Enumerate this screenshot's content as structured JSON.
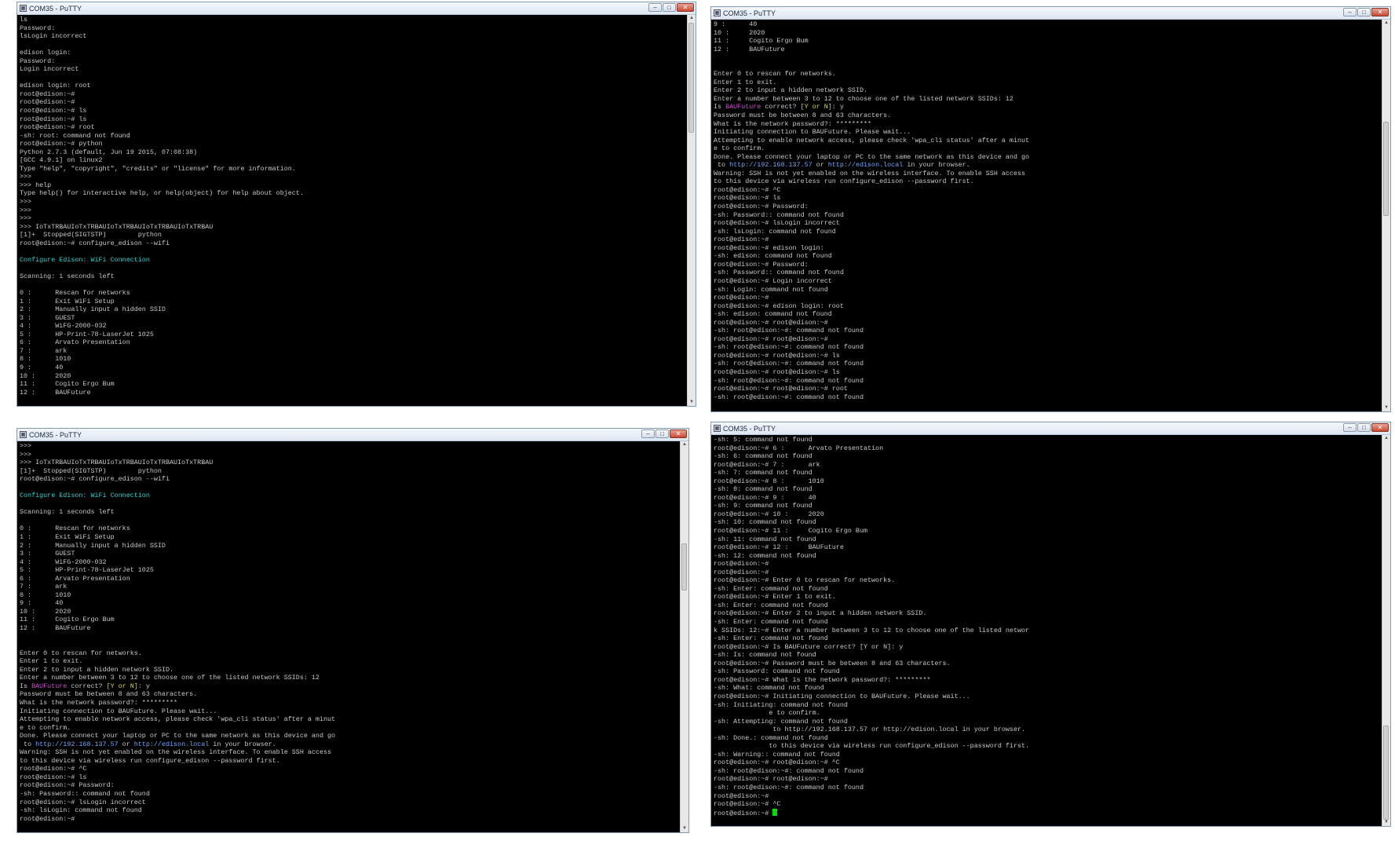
{
  "windows": [
    {
      "title": "COM35 - PuTTY",
      "lines": [
        "ls",
        "Password:",
        "lsLogin incorrect",
        "",
        "edison login:",
        "Password:",
        "Login incorrect",
        "",
        "edison login: root",
        "root@edison:~#",
        "root@edison:~#",
        "root@edison:~# ls",
        "root@edison:~# ls",
        "root@edison:~# root",
        "-sh: root: command not found",
        "root@edison:~# python",
        "Python 2.7.3 (default, Jun 19 2015, 07:08:38)",
        "[GCC 4.9.1] on linux2",
        "Type \"help\", \"copyright\", \"credits\" or \"license\" for more information.",
        ">>>",
        ">>> help",
        "Type help() for interactive help, or help(object) for help about object.",
        ">>>",
        ">>>",
        ">>>",
        ">>> IoTxTRBAUIoTxTRBAUIoTxTRBAUIoTxTRBAUIoTxTRBAU",
        "[1]+  Stopped(SIGTSTP)        python",
        "root@edison:~# configure_edison --wifi",
        "",
        [
          {
            "t": "Configure Edison: WiFi Connection",
            "c": "cyan"
          }
        ],
        "",
        "Scanning: 1 seconds left",
        "",
        "0 :      Rescan for networks",
        "1 :      Exit WiFi Setup",
        "2 :      Manually input a hidden SSID",
        "3 :      GUEST",
        "4 :      WiFG-2000-032",
        "5 :      HP-Print-78-LaserJet 1025",
        "6 :      Arvato Presentation",
        "7 :      ark",
        "8 :      1010",
        "9 :      40",
        "10 :     2020",
        "11 :     Cogito Ergo Bum",
        "12 :     BAUFuture"
      ]
    },
    {
      "title": "COM35 - PuTTY",
      "lines": [
        "9 :      40",
        "10 :     2020",
        "11 :     Cogito Ergo Bum",
        "12 :     BAUFuture",
        "",
        "",
        "Enter 0 to rescan for networks.",
        "Enter 1 to exit.",
        "Enter 2 to input a hidden network SSID.",
        "Enter a number between 3 to 12 to choose one of the listed network SSIDs: 12",
        [
          {
            "t": "Is "
          },
          {
            "t": "BAUFuture",
            "c": "magenta"
          },
          {
            "t": " correct? "
          },
          {
            "t": "[Y or N]",
            "c": "yellow"
          },
          {
            "t": ": y"
          }
        ],
        "Password must be between 8 and 63 characters.",
        "What is the network password?: *********",
        "Initiating connection to BAUFuture. Please wait...",
        "Attempting to enable network access, please check 'wpa_cli status' after a minut",
        "e to confirm.",
        "Done. Please connect your laptop or PC to the same network as this device and go",
        [
          {
            "t": " to "
          },
          {
            "t": "http://192.168.137.57",
            "c": "link"
          },
          {
            "t": " or "
          },
          {
            "t": "http://edison.local",
            "c": "link"
          },
          {
            "t": " in your browser."
          }
        ],
        "Warning: SSH is not yet enabled on the wireless interface. To enable SSH access",
        "to this device via wireless run configure_edison --password first.",
        "root@edison:~# ^C",
        "root@edison:~# ls",
        "root@edison:~# Password:",
        "-sh: Password:: command not found",
        "root@edison:~# lsLogin incorrect",
        "-sh: lsLogin: command not found",
        "root@edison:~#",
        "root@edison:~# edison login:",
        "-sh: edison: command not found",
        "root@edison:~# Password:",
        "-sh: Password:: command not found",
        "root@edison:~# Login incorrect",
        "-sh: Login: command not found",
        "root@edison:~#",
        "root@edison:~# edison login: root",
        "-sh: edison: command not found",
        "root@edison:~# root@edison:~#",
        "-sh: root@edison:~#: command not found",
        "root@edison:~# root@edison:~#",
        "-sh: root@edison:~#: command not found",
        "root@edison:~# root@edison:~# ls",
        "-sh: root@edison:~#: command not found",
        "root@edison:~# root@edison:~# ls",
        "-sh: root@edison:~#: command not found",
        "root@edison:~# root@edison:~# root",
        "-sh: root@edison:~#: command not found"
      ]
    },
    {
      "title": "COM35 - PuTTY",
      "lines": [
        ">>>",
        ">>>",
        ">>> IoTxTRBAUIoTxTRBAUIoTxTRBAUIoTxTRBAUIoTxTRBAU",
        "[1]+  Stopped(SIGTSTP)        python",
        "root@edison:~# configure_edison --wifi",
        "",
        [
          {
            "t": "Configure Edison: WiFi Connection",
            "c": "cyan"
          }
        ],
        "",
        "Scanning: 1 seconds left",
        "",
        "0 :      Rescan for networks",
        "1 :      Exit WiFi Setup",
        "2 :      Manually input a hidden SSID",
        "3 :      GUEST",
        "4 :      WiFG-2000-032",
        "5 :      HP-Print-78-LaserJet 1025",
        "6 :      Arvato Presentation",
        "7 :      ark",
        "8 :      1010",
        "9 :      40",
        "10 :     2020",
        "11 :     Cogito Ergo Bum",
        "12 :     BAUFuture",
        "",
        "",
        "Enter 0 to rescan for networks.",
        "Enter 1 to exit.",
        "Enter 2 to input a hidden network SSID.",
        "Enter a number between 3 to 12 to choose one of the listed network SSIDs: 12",
        [
          {
            "t": "Is "
          },
          {
            "t": "BAUFuture",
            "c": "magenta"
          },
          {
            "t": " correct? "
          },
          {
            "t": "[Y or N]",
            "c": "yellow"
          },
          {
            "t": ": y"
          }
        ],
        "Password must be between 8 and 63 characters.",
        "What is the network password?: *********",
        "Initiating connection to BAUFuture. Please wait...",
        "Attempting to enable network access, please check 'wpa_cli status' after a minut",
        "e to confirm.",
        "Done. Please connect your laptop or PC to the same network as this device and go",
        [
          {
            "t": " to "
          },
          {
            "t": "http://192.168.137.57",
            "c": "link"
          },
          {
            "t": " or "
          },
          {
            "t": "http://edison.local",
            "c": "link"
          },
          {
            "t": " in your browser."
          }
        ],
        "Warning: SSH is not yet enabled on the wireless interface. To enable SSH access",
        "to this device via wireless run configure_edison --password first.",
        "root@edison:~# ^C",
        "root@edison:~# ls",
        "root@edison:~# Password:",
        "-sh: Password:: command not found",
        "root@edison:~# lsLogin incorrect",
        "-sh: lsLogin: command not found",
        "root@edison:~#"
      ]
    },
    {
      "title": "COM35 - PuTTY",
      "cursor_last_line": true,
      "lines": [
        "-sh: 5: command not found",
        "root@edison:~# 6 :      Arvato Presentation",
        "-sh: 6: command not found",
        "root@edison:~# 7 :      ark",
        "-sh: 7: command not found",
        "root@edison:~# 8 :      1010",
        "-sh: 8: command not found",
        "root@edison:~# 9 :      40",
        "-sh: 9: command not found",
        "root@edison:~# 10 :     2020",
        "-sh: 10: command not found",
        "root@edison:~# 11 :     Cogito Ergo Bum",
        "-sh: 11: command not found",
        "root@edison:~# 12 :     BAUFuture",
        "-sh: 12: command not found",
        "root@edison:~#",
        "root@edison:~#",
        "root@edison:~# Enter 0 to rescan for networks.",
        "-sh: Enter: command not found",
        "root@edison:~# Enter 1 to exit.",
        "-sh: Enter: command not found",
        "root@edison:~# Enter 2 to input a hidden network SSID.",
        "-sh: Enter: command not found",
        "k SSIDs: 12:~# Enter a number between 3 to 12 to choose one of the listed networ",
        "-sh: Enter: command not found",
        "root@edison:~# Is BAUFuture correct? [Y or N]: y",
        "-sh: Is: command not found",
        "root@edison:~# Password must be between 8 and 63 characters.",
        "-sh: Password: command not found",
        "root@edison:~# What is the network password?: *********",
        "-sh: What: command not found",
        "root@edison:~# Initiating connection to BAUFuture. Please wait...",
        "-sh: Initiating: command not found",
        "              e to confirm.",
        "-sh: Attempting: command not found",
        "               to http://192.168.137.57 or http://edison.local in your browser.",
        "-sh: Done.: command not found",
        "              to this device via wireless run configure_edison --password first.",
        "-sh: Warning:: command not found",
        "root@edison:~# root@edison:~# ^C",
        "-sh: root@edison:~#: command not found",
        "root@edison:~# root@edison:~#",
        "-sh: root@edison:~#: command not found",
        "root@edison:~#",
        "root@edison:~# ^C",
        "root@edison:~# "
      ]
    }
  ]
}
